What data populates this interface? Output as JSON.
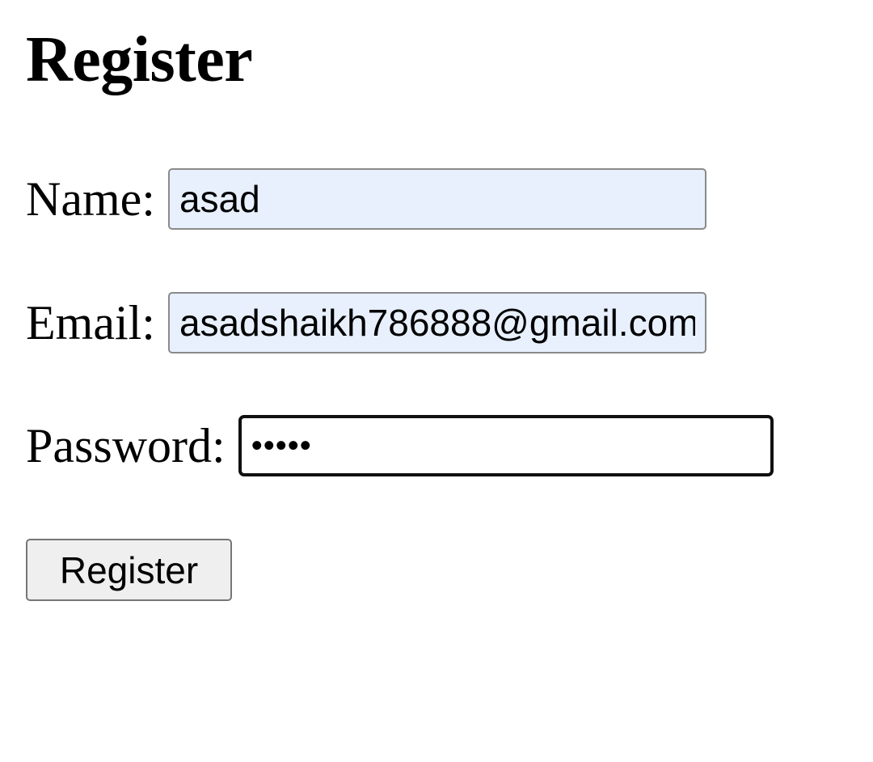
{
  "form": {
    "title": "Register",
    "name": {
      "label": "Name:",
      "value": "asad"
    },
    "email": {
      "label": "Email:",
      "value": "asadshaikh786888@gmail.com"
    },
    "password": {
      "label": "Password:",
      "value": "•••••"
    },
    "submit_label": "Register"
  },
  "colors": {
    "autofill_background": "#e8f0fe",
    "button_background": "#efefef",
    "focus_border": "#101010"
  }
}
